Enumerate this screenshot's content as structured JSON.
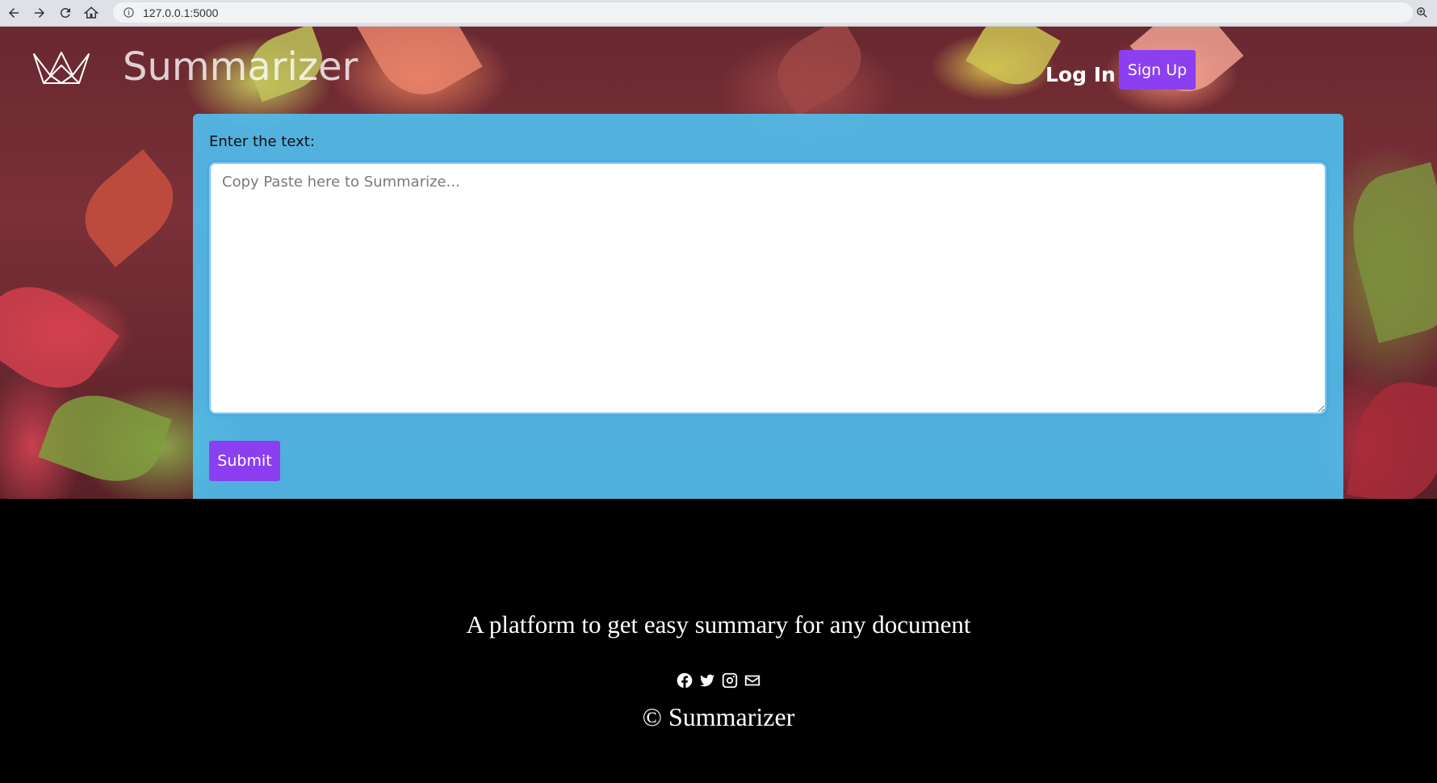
{
  "browser": {
    "url": "127.0.0.1:5000"
  },
  "header": {
    "brand_name": "Summarizer",
    "login_label": "Log In",
    "signup_label": "Sign Up"
  },
  "form": {
    "label": "Enter the text:",
    "placeholder": "Copy Paste here to Summarize...",
    "submit_label": "Submit"
  },
  "footer": {
    "tagline": "A platform to get easy summary for any document",
    "copyright": "© Summarizer",
    "social_icons": [
      "facebook-icon",
      "twitter-icon",
      "instagram-icon",
      "email-icon"
    ]
  },
  "colors": {
    "accent_button": "#8b3ff0",
    "card_background": "#4ec4f6",
    "footer_background": "#000000"
  }
}
